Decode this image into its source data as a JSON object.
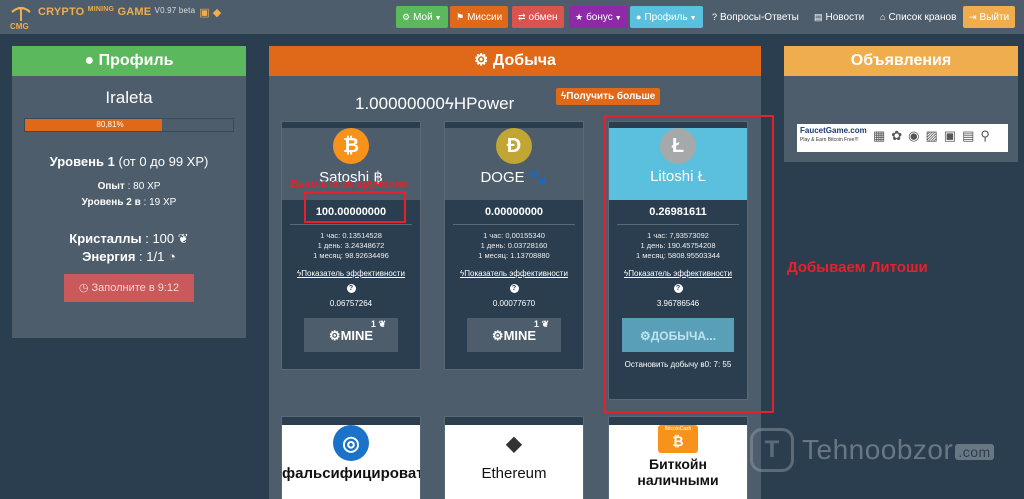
{
  "brand": {
    "logo_text": "CMG",
    "name_part1": "CRYPTO",
    "name_sup": "MINING",
    "name_part2": "GAME",
    "version": "V0.97 beta",
    "social_icons": [
      "facebook-icon",
      "chat-icon"
    ]
  },
  "nav": [
    {
      "id": "my",
      "label": "Мой",
      "icon": "gear-icon",
      "color": "#5cb85c",
      "caret": true
    },
    {
      "id": "missions",
      "label": "Миссии",
      "icon": "flag-icon",
      "color": "#df6919",
      "caret": false
    },
    {
      "id": "exchange",
      "label": "обмен",
      "icon": "exchange-icon",
      "color": "#d9534f",
      "caret": false
    },
    {
      "id": "bonus",
      "label": "бонус",
      "icon": "star-icon",
      "color": "#8e2aa8",
      "caret": true
    },
    {
      "id": "profile",
      "label": "Профиль",
      "icon": "user-icon",
      "color": "#5bc0de",
      "caret": true
    },
    {
      "id": "faq",
      "label": "Вопросы-Ответы",
      "icon": "question-icon",
      "color": "#4e5d6c",
      "caret": false
    },
    {
      "id": "news",
      "label": "Новости",
      "icon": "newspaper-icon",
      "color": "#4e5d6c",
      "caret": false
    },
    {
      "id": "faucets",
      "label": "Список кранов",
      "icon": "faucet-icon",
      "color": "#4e5d6c",
      "caret": false
    },
    {
      "id": "logout",
      "label": "Выйти",
      "icon": "logout-icon",
      "color": "#f0ad4e",
      "caret": false
    }
  ],
  "profile": {
    "header": "Профиль",
    "username": "Iraleta",
    "xp_percent_text": "80,81%",
    "xp_fraction": 0.8081,
    "level_label": "Уровень 1",
    "level_range": "(от 0 до 99 XP)",
    "exp_label": "Опыт",
    "exp_value": "80 XP",
    "level2_label": "Уровень 2 в",
    "level2_value": "19 XP",
    "crystals_label": "Кристаллы",
    "crystals_value": "100",
    "energy_label": "Энергия",
    "energy_value": "1/1",
    "refill_button": "Заполните в 9:12"
  },
  "mining": {
    "header": "Добыча",
    "hpower_value": "1.00000000",
    "hpower_unit": "HPower",
    "get_more_button": "Получить больше",
    "coins": [
      {
        "name": "Satoshi",
        "symbol": "฿",
        "icon": "bitcoin-icon",
        "icon_color": "#f7931a",
        "balance": "100.00000000",
        "rate_hour": "1 час: 0.13514528",
        "rate_day": "1 день: 3.24348672",
        "rate_month": "1 месяц: 98.92634496",
        "efficiency_link": "Показатель эффективности",
        "efficiency_value": "0.06757264",
        "button": "MINE",
        "button_sup": "1",
        "highlight": false
      },
      {
        "name": "DOGE",
        "symbol": "🐾",
        "icon": "dogecoin-icon",
        "icon_color": "#c2a633",
        "balance": "0.00000000",
        "rate_hour": "1 час: 0,00155340",
        "rate_day": "1 день: 0.03728160",
        "rate_month": "1 месяц: 1.13708880",
        "efficiency_link": "Показатель эффективности",
        "efficiency_value": "0.00077670",
        "button": "MINE",
        "button_sup": "1",
        "highlight": false
      },
      {
        "name": "Litoshi",
        "symbol": "Ł",
        "icon": "litecoin-icon",
        "icon_color": "#a6a9aa",
        "balance": "0.26981611",
        "rate_hour": "1 час: 7,93573092",
        "rate_day": "1 день: 190.45754208",
        "rate_month": "1 месяц: 5808.95503344",
        "efficiency_link": "Показатель эффективности",
        "efficiency_value": "3.96786546",
        "button": "ДОБЫЧА...",
        "stop_text": "Остановить добычу в0: 7: 55",
        "highlight": true
      }
    ],
    "row2": [
      {
        "name": "фальсифицироват",
        "icon": "counterfeit-coin-icon"
      },
      {
        "name": "Ethereum",
        "icon": "ethereum-icon"
      },
      {
        "name": "Биткойн наличными",
        "icon": "bitcoin-cash-icon",
        "badge": "BitcoinCash"
      }
    ]
  },
  "ads": {
    "header": "Объявления",
    "banner_text": "FaucetGame.com",
    "banner_sub": "Play & Earn Bitcoin Free!!!"
  },
  "annotations": {
    "withdraw_label": "Выплата за вручение",
    "litoshi_label": "Добываем Литоши"
  },
  "watermark": {
    "text": "Tehnoobzor",
    "suffix": ".com"
  }
}
